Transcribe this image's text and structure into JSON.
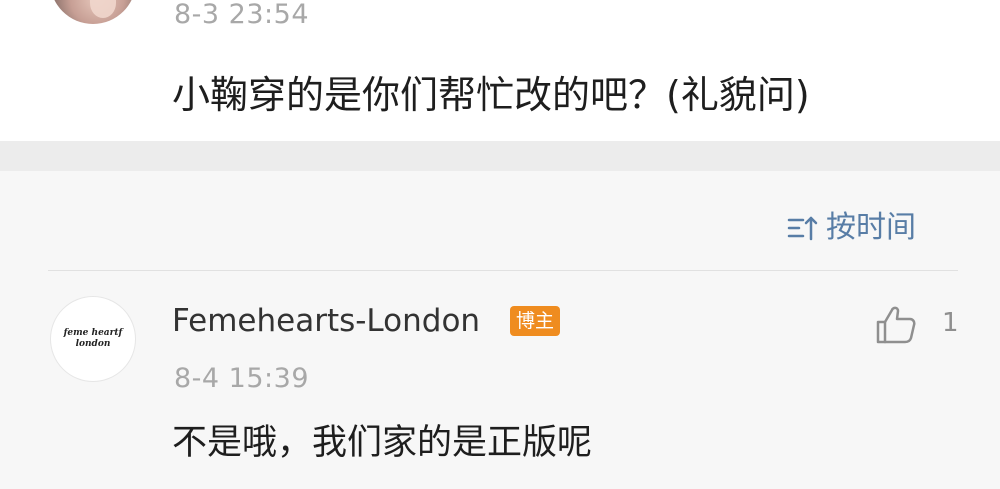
{
  "colors": {
    "background": "#f7f7f7",
    "card": "#ffffff",
    "band": "#ececec",
    "link_blue": "#587da6",
    "badge_orange": "#ef8c1f",
    "muted_gray": "#a8a8a8",
    "text_dark": "#1e1e1e"
  },
  "top_comment": {
    "time": "8-3 23:54",
    "text": "小鞠穿的是你们帮忙改的吧？(礼貌问)",
    "avatar_icon": "user-photo-avatar"
  },
  "sort": {
    "icon": "sort-lines-icon",
    "label": "按时间"
  },
  "reply": {
    "avatar_logo_line1": "feme heartf",
    "avatar_logo_line2": "london",
    "username": "Femehearts-London",
    "badge": "博主",
    "like_icon": "thumbs-up-icon",
    "like_count": "1",
    "time": "8-4 15:39",
    "text": "不是哦，我们家的是正版呢"
  }
}
